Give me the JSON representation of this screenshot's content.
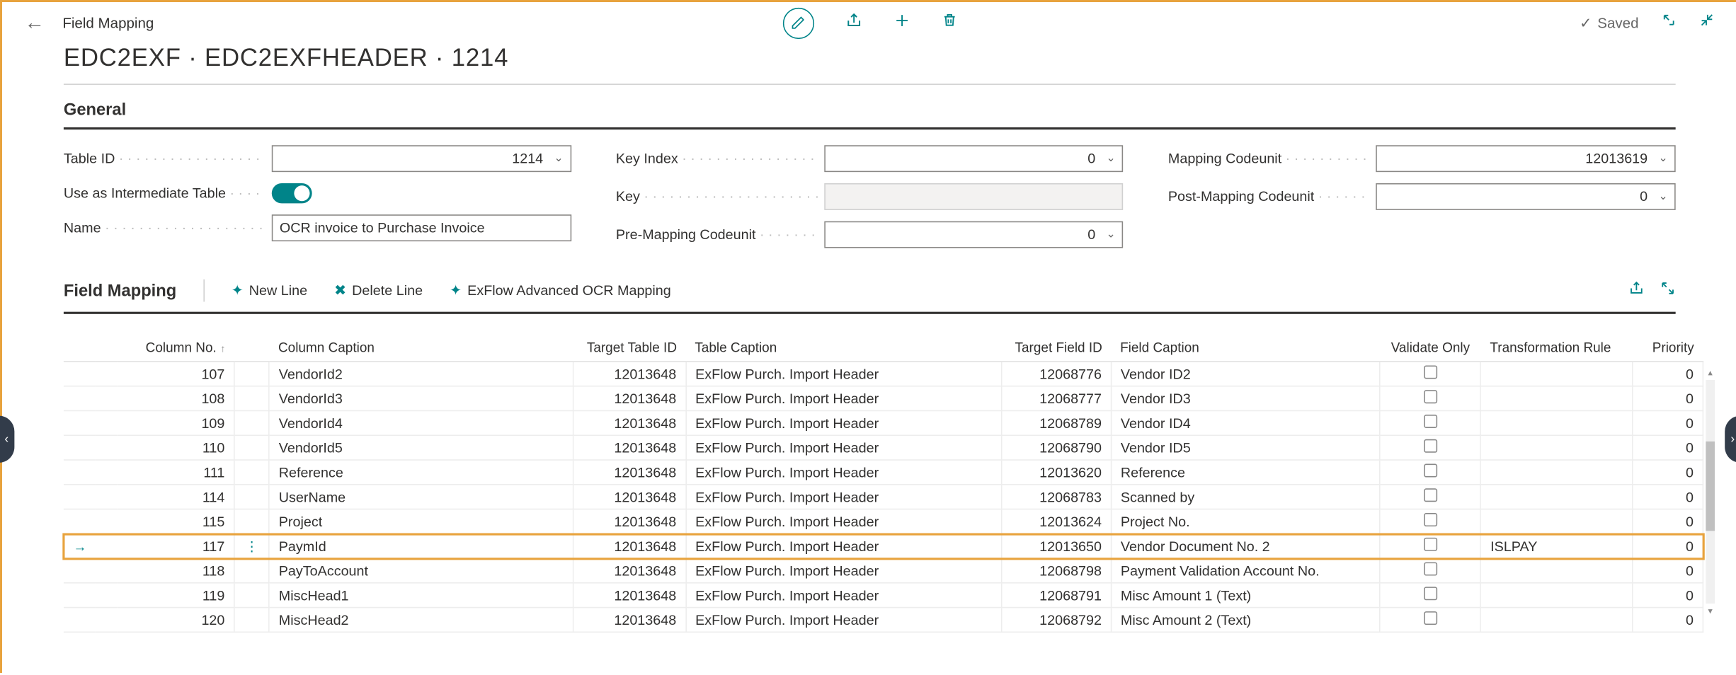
{
  "breadcrumb": "Field Mapping",
  "page_title": "EDC2EXF · EDC2EXFHEADER · 1214",
  "saved_label": "Saved",
  "sections": {
    "general": "General",
    "field_mapping": "Field Mapping"
  },
  "general": {
    "table_id": {
      "label": "Table ID",
      "value": "1214"
    },
    "use_intermediate": {
      "label": "Use as Intermediate Table",
      "on": true
    },
    "name": {
      "label": "Name",
      "value": "OCR invoice to Purchase Invoice"
    },
    "key_index": {
      "label": "Key Index",
      "value": "0"
    },
    "key": {
      "label": "Key",
      "value": ""
    },
    "pre_mapping": {
      "label": "Pre-Mapping Codeunit",
      "value": "0"
    },
    "mapping_codeunit": {
      "label": "Mapping Codeunit",
      "value": "12013619"
    },
    "post_mapping": {
      "label": "Post-Mapping Codeunit",
      "value": "0"
    }
  },
  "actions": {
    "new_line": "New Line",
    "delete_line": "Delete Line",
    "exflow_mapping": "ExFlow Advanced OCR Mapping"
  },
  "table": {
    "headers": {
      "column_no": "Column No.",
      "column_caption": "Column Caption",
      "target_table_id": "Target Table ID",
      "table_caption": "Table Caption",
      "target_field_id": "Target Field ID",
      "field_caption": "Field Caption",
      "validate_only": "Validate Only",
      "transformation_rule": "Transformation Rule",
      "priority": "Priority"
    },
    "rows": [
      {
        "col_no": "107",
        "col_caption": "VendorId2",
        "target_table": "12013648",
        "table_caption": "ExFlow Purch. Import Header",
        "target_field": "12068776",
        "field_caption": "Vendor ID2",
        "validate": false,
        "rule": "",
        "priority": "0",
        "selected": false
      },
      {
        "col_no": "108",
        "col_caption": "VendorId3",
        "target_table": "12013648",
        "table_caption": "ExFlow Purch. Import Header",
        "target_field": "12068777",
        "field_caption": "Vendor ID3",
        "validate": false,
        "rule": "",
        "priority": "0",
        "selected": false
      },
      {
        "col_no": "109",
        "col_caption": "VendorId4",
        "target_table": "12013648",
        "table_caption": "ExFlow Purch. Import Header",
        "target_field": "12068789",
        "field_caption": "Vendor ID4",
        "validate": false,
        "rule": "",
        "priority": "0",
        "selected": false
      },
      {
        "col_no": "110",
        "col_caption": "VendorId5",
        "target_table": "12013648",
        "table_caption": "ExFlow Purch. Import Header",
        "target_field": "12068790",
        "field_caption": "Vendor ID5",
        "validate": false,
        "rule": "",
        "priority": "0",
        "selected": false
      },
      {
        "col_no": "111",
        "col_caption": "Reference",
        "target_table": "12013648",
        "table_caption": "ExFlow Purch. Import Header",
        "target_field": "12013620",
        "field_caption": "Reference",
        "validate": false,
        "rule": "",
        "priority": "0",
        "selected": false
      },
      {
        "col_no": "114",
        "col_caption": "UserName",
        "target_table": "12013648",
        "table_caption": "ExFlow Purch. Import Header",
        "target_field": "12068783",
        "field_caption": "Scanned by",
        "validate": false,
        "rule": "",
        "priority": "0",
        "selected": false
      },
      {
        "col_no": "115",
        "col_caption": "Project",
        "target_table": "12013648",
        "table_caption": "ExFlow Purch. Import Header",
        "target_field": "12013624",
        "field_caption": "Project No.",
        "validate": false,
        "rule": "",
        "priority": "0",
        "selected": false
      },
      {
        "col_no": "117",
        "col_caption": "PaymId",
        "target_table": "12013648",
        "table_caption": "ExFlow Purch. Import Header",
        "target_field": "12013650",
        "field_caption": "Vendor Document No. 2",
        "validate": false,
        "rule": "ISLPAY",
        "priority": "0",
        "selected": true
      },
      {
        "col_no": "118",
        "col_caption": "PayToAccount",
        "target_table": "12013648",
        "table_caption": "ExFlow Purch. Import Header",
        "target_field": "12068798",
        "field_caption": "Payment Validation Account No.",
        "validate": false,
        "rule": "",
        "priority": "0",
        "selected": false
      },
      {
        "col_no": "119",
        "col_caption": "MiscHead1",
        "target_table": "12013648",
        "table_caption": "ExFlow Purch. Import Header",
        "target_field": "12068791",
        "field_caption": "Misc Amount 1 (Text)",
        "validate": false,
        "rule": "",
        "priority": "0",
        "selected": false
      },
      {
        "col_no": "120",
        "col_caption": "MiscHead2",
        "target_table": "12013648",
        "table_caption": "ExFlow Purch. Import Header",
        "target_field": "12068792",
        "field_caption": "Misc Amount 2 (Text)",
        "validate": false,
        "rule": "",
        "priority": "0",
        "selected": false
      }
    ]
  }
}
